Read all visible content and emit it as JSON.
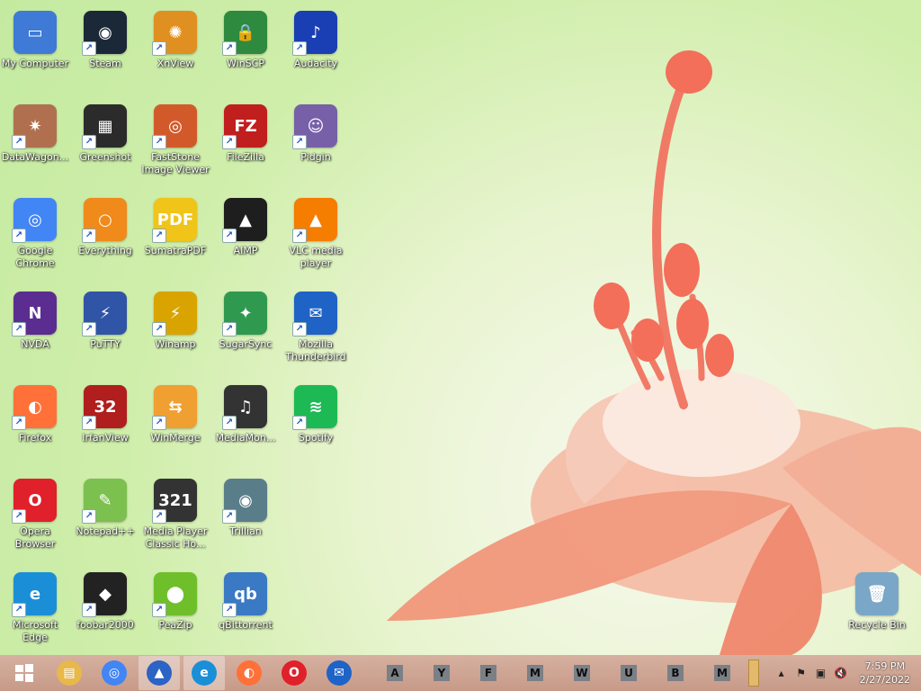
{
  "desktop": {
    "icons": [
      {
        "label": "My Computer",
        "icon": "computer-icon",
        "color": "#3e7ad6",
        "glyph": "▭"
      },
      {
        "label": "Steam",
        "icon": "steam-icon",
        "color": "#1b2838",
        "glyph": "◉"
      },
      {
        "label": "XnView",
        "icon": "xnview-icon",
        "color": "#e09020",
        "glyph": "✺"
      },
      {
        "label": "WinSCP",
        "icon": "winscp-icon",
        "color": "#2d8a3f",
        "glyph": "🔒"
      },
      {
        "label": "Audacity",
        "icon": "audacity-icon",
        "color": "#1a3fb5",
        "glyph": "♪"
      },
      {
        "label": "DataWagon...",
        "icon": "datawagon-icon",
        "color": "#b07050",
        "glyph": "✷"
      },
      {
        "label": "Greenshot",
        "icon": "greenshot-icon",
        "color": "#2b2b2b",
        "glyph": "▦"
      },
      {
        "label": "FastStone Image Viewer",
        "icon": "faststone-icon",
        "color": "#d25a2a",
        "glyph": "◎"
      },
      {
        "label": "FileZilla",
        "icon": "filezilla-icon",
        "color": "#c11e1e",
        "glyph": "FZ"
      },
      {
        "label": "Pidgin",
        "icon": "pidgin-icon",
        "color": "#7760a8",
        "glyph": "☺"
      },
      {
        "label": "Google Chrome",
        "icon": "chrome-icon",
        "color": "#4285f4",
        "glyph": "◎"
      },
      {
        "label": "Everything",
        "icon": "everything-icon",
        "color": "#f08a1a",
        "glyph": "○"
      },
      {
        "label": "SumatraPDF",
        "icon": "sumatrapdf-icon",
        "color": "#f0c419",
        "glyph": "PDF"
      },
      {
        "label": "AIMP",
        "icon": "aimp-icon",
        "color": "#1e1e1e",
        "glyph": "▲"
      },
      {
        "label": "VLC media player",
        "icon": "vlc-icon",
        "color": "#f57d00",
        "glyph": "▲"
      },
      {
        "label": "NVDA",
        "icon": "nvda-icon",
        "color": "#5b2d91",
        "glyph": "N"
      },
      {
        "label": "PuTTY",
        "icon": "putty-icon",
        "color": "#3054a6",
        "glyph": "⚡"
      },
      {
        "label": "Winamp",
        "icon": "winamp-icon",
        "color": "#d9a400",
        "glyph": "⚡"
      },
      {
        "label": "SugarSync",
        "icon": "sugarsync-icon",
        "color": "#2f9a4f",
        "glyph": "✦"
      },
      {
        "label": "Mozilla Thunderbird",
        "icon": "thunderbird-icon",
        "color": "#1f63c7",
        "glyph": "✉"
      },
      {
        "label": "Firefox",
        "icon": "firefox-icon",
        "color": "#ff7139",
        "glyph": "◐"
      },
      {
        "label": "IrfanView",
        "icon": "irfanview-icon",
        "color": "#b01e1e",
        "glyph": "32"
      },
      {
        "label": "WinMerge",
        "icon": "winmerge-icon",
        "color": "#f0a030",
        "glyph": "⇆"
      },
      {
        "label": "MediaMon...",
        "icon": "mediamonkey-icon",
        "color": "#333333",
        "glyph": "♫"
      },
      {
        "label": "Spotify",
        "icon": "spotify-icon",
        "color": "#1db954",
        "glyph": "≋"
      },
      {
        "label": "Opera Browser",
        "icon": "opera-icon",
        "color": "#e0202a",
        "glyph": "O"
      },
      {
        "label": "Notepad++",
        "icon": "notepadpp-icon",
        "color": "#7cc050",
        "glyph": "✎"
      },
      {
        "label": "Media Player Classic Ho...",
        "icon": "mpc-icon",
        "color": "#333333",
        "glyph": "321"
      },
      {
        "label": "Trillian",
        "icon": "trillian-icon",
        "color": "#5a7d8a",
        "glyph": "◉"
      },
      {
        "label": "Microsoft Edge",
        "icon": "edge-icon",
        "color": "#1a8fd8",
        "glyph": "e"
      },
      {
        "label": "foobar2000",
        "icon": "foobar2000-icon",
        "color": "#222222",
        "glyph": "◆"
      },
      {
        "label": "PeaZip",
        "icon": "peazip-icon",
        "color": "#6fbf2a",
        "glyph": "⬤"
      },
      {
        "label": "qBittorrent",
        "icon": "qbittorrent-icon",
        "color": "#3a79c4",
        "glyph": "qb"
      },
      {
        "label": "Recycle Bin",
        "icon": "recycle-bin-icon",
        "color": "#7aa7c7",
        "glyph": "🗑"
      }
    ]
  },
  "taskbar": {
    "start_icon": "windows-start-icon",
    "pinned": [
      {
        "name": "file-explorer-icon",
        "color": "#e8b84a",
        "glyph": "▤"
      },
      {
        "name": "chrome-icon",
        "color": "#4285f4",
        "glyph": "◎"
      },
      {
        "name": "app-icon",
        "color": "#2c63c4",
        "glyph": "▲"
      },
      {
        "name": "edge-icon",
        "color": "#1a8fd8",
        "glyph": "e"
      },
      {
        "name": "firefox-icon",
        "color": "#ff7139",
        "glyph": "◐"
      },
      {
        "name": "opera-icon",
        "color": "#e0202a",
        "glyph": "O"
      },
      {
        "name": "thunderbird-icon",
        "color": "#1f63c7",
        "glyph": "✉"
      }
    ],
    "letters": [
      "A",
      "Y",
      "F",
      "M",
      "W",
      "U",
      "B",
      "M"
    ],
    "tray_icons": [
      "show-hidden-icons-icon",
      "action-center-flag-icon",
      "network-icon",
      "volume-muted-icon"
    ],
    "time": "7:59 PM",
    "date": "2/27/2022"
  }
}
